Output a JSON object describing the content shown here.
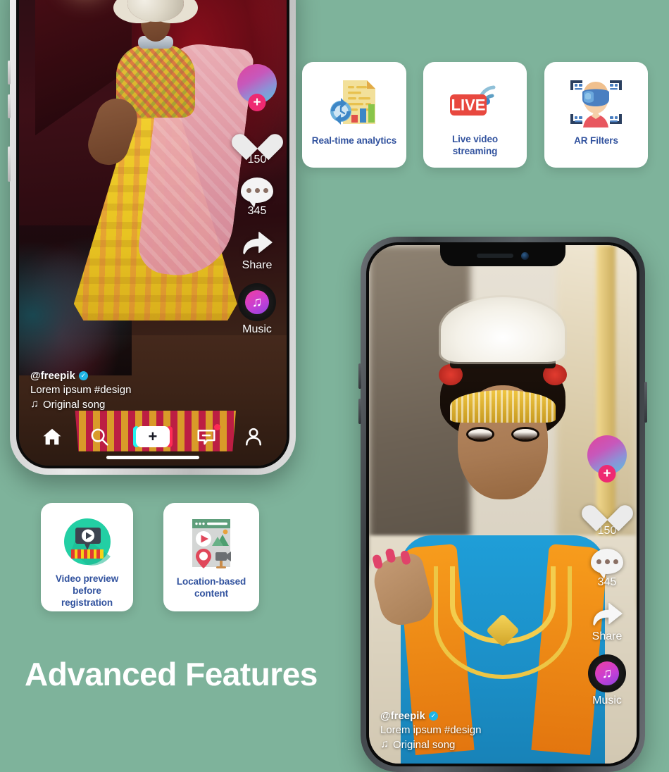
{
  "theme": {
    "background_color": "#7eb39b",
    "card_background": "#ffffff",
    "card_label_color": "#31529e",
    "heading_color": "#ffffff",
    "accent_pink": "#fe2c55",
    "accent_teal": "#25f4ee",
    "live_red": "#e8483f"
  },
  "heading": {
    "title": "Advanced Features"
  },
  "feature_cards": [
    {
      "id": "analytics",
      "icon": "document-analytics-icon",
      "label": "Real-time analytics"
    },
    {
      "id": "live",
      "icon": "live-streaming-icon",
      "label": "Live video streaming"
    },
    {
      "id": "ar",
      "icon": "ar-face-filter-icon",
      "label": "AR Filters"
    },
    {
      "id": "preview",
      "icon": "video-preview-icon",
      "label": "Video preview\nbefore registration",
      "label_line1": "Video preview",
      "label_line2": "before registration"
    },
    {
      "id": "location",
      "icon": "location-content-icon",
      "label": "Location-based\ncontent",
      "label_line1": "Location-based",
      "label_line2": "content"
    }
  ],
  "live_badge": {
    "text": "LIVE"
  },
  "phones": [
    {
      "id": "phone-left",
      "frame_color": "silver",
      "video_subject": "fashion runway model in yellow lehenga",
      "overlay": {
        "avatar": {
          "plus_label": "+"
        },
        "like": {
          "icon": "heart-icon",
          "count": "150"
        },
        "comment": {
          "icon": "comment-bubble-icon",
          "count": "345"
        },
        "share": {
          "icon": "share-arrow-icon",
          "label": "Share"
        },
        "music": {
          "icon": "music-note-icon",
          "label": "Music",
          "note_glyph": "♫"
        },
        "caption": {
          "handle": "@freepik",
          "verified_glyph": "✓",
          "text": "Lorem ipsum #design",
          "song_note_glyph": "♫",
          "song": "Original song"
        },
        "tabbar": [
          {
            "name": "home",
            "icon": "home-icon",
            "active": true,
            "badge": false
          },
          {
            "name": "discover",
            "icon": "search-icon",
            "active": false,
            "badge": false
          },
          {
            "name": "create",
            "icon": "plus-icon",
            "label": "+",
            "badge": false
          },
          {
            "name": "inbox",
            "icon": "inbox-icon",
            "active": false,
            "badge": true
          },
          {
            "name": "profile",
            "icon": "person-icon",
            "active": false,
            "badge": false
          }
        ]
      }
    },
    {
      "id": "phone-right",
      "frame_color": "dark-graphite",
      "video_subject": "young bharatanatyam dancer in blue and orange costume",
      "overlay": {
        "avatar": {
          "plus_label": "+"
        },
        "like": {
          "icon": "heart-icon",
          "count": "150"
        },
        "comment": {
          "icon": "comment-bubble-icon",
          "count": "345"
        },
        "share": {
          "icon": "share-arrow-icon",
          "label": "Share"
        },
        "music": {
          "icon": "music-note-icon",
          "label": "Music",
          "note_glyph": "♫"
        },
        "caption": {
          "handle": "@freepik",
          "verified_glyph": "✓",
          "text": "Lorem ipsum #design",
          "song_note_glyph": "♫",
          "song": "Original song"
        }
      }
    }
  ]
}
